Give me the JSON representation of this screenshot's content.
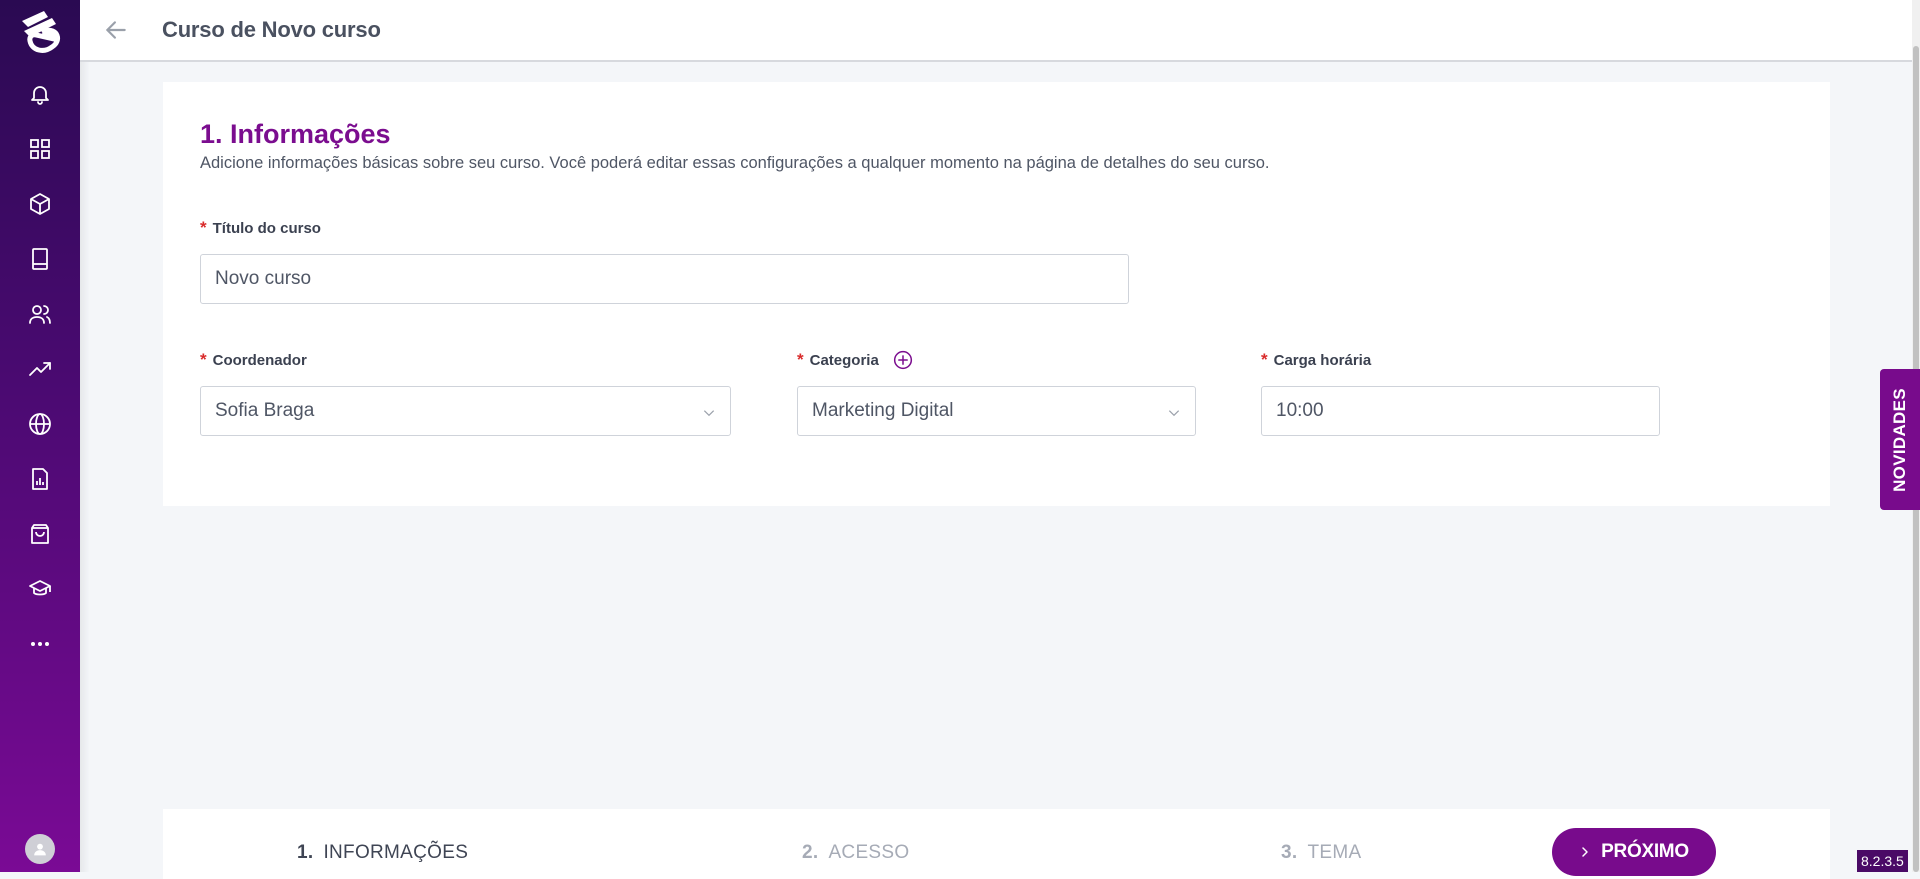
{
  "colors": {
    "brand": "#780b8c",
    "title_purple": "#7b0d8f",
    "required": "#d92b2b"
  },
  "sidebar": {
    "logo": "edools-logo-icon",
    "items": [
      {
        "icon": "bell-icon"
      },
      {
        "icon": "grid-icon"
      },
      {
        "icon": "box-icon"
      },
      {
        "icon": "book-icon"
      },
      {
        "icon": "users-icon"
      },
      {
        "icon": "trending-up-icon"
      },
      {
        "icon": "globe-icon"
      },
      {
        "icon": "report-icon"
      },
      {
        "icon": "shopping-bag-icon"
      },
      {
        "icon": "graduation-cap-icon"
      },
      {
        "icon": "more-icon"
      }
    ],
    "avatar": "user-avatar-icon"
  },
  "header": {
    "title": "Curso de Novo curso"
  },
  "form": {
    "section_title": "1. Informações",
    "section_description": "Adicione informações básicas sobre seu curso. Você poderá editar essas configurações a qualquer momento na página de detalhes do seu curso.",
    "required_mark": "*",
    "title_label": "Título do curso",
    "title_value": "Novo curso",
    "coordinator_label": "Coordenador",
    "coordinator_value": "Sofia Braga",
    "category_label": "Categoria",
    "category_value": "Marketing Digital",
    "workload_label": "Carga horária",
    "workload_value": "10:00"
  },
  "stepper": {
    "steps": [
      {
        "num": "1.",
        "label": "INFORMAÇÕES"
      },
      {
        "num": "2.",
        "label": "ACESSO"
      },
      {
        "num": "3.",
        "label": "TEMA"
      }
    ],
    "next_label": "PRÓXIMO"
  },
  "novidades_label": "NOVIDADES",
  "version": "8.2.3.5"
}
